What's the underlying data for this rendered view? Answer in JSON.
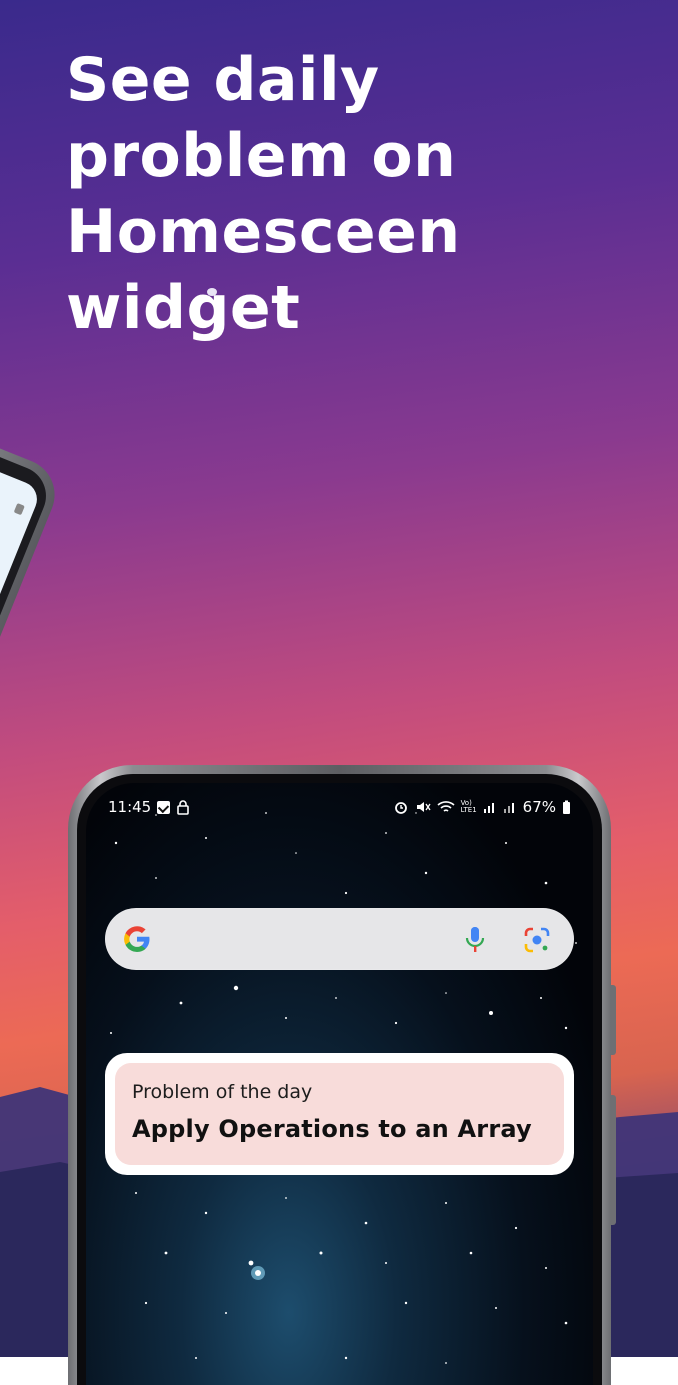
{
  "headline": "See daily problem on Homesceen widget",
  "phone": {
    "status_bar": {
      "time": "11:45",
      "battery": "67%",
      "network_label": "Vo)\nLTE1"
    },
    "search_bar": {
      "logo": "google-g-icon",
      "mic": "mic-icon",
      "lens": "lens-icon"
    },
    "widget": {
      "caption": "Problem of the day",
      "title": "Apply Operations to an Array"
    }
  },
  "colors": {
    "widget_bg": "#f8dcda",
    "search_bg": "#e6e6e8"
  }
}
